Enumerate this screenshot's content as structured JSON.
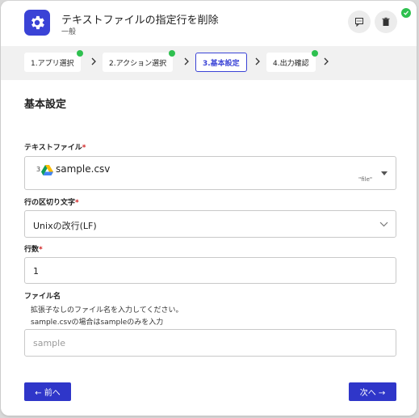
{
  "header": {
    "title": "テキストファイルの指定行を削除",
    "subtitle": "一般",
    "icon": "gear-icon",
    "comment_icon": "comment-icon",
    "delete_icon": "trash-icon",
    "status_icon": "check-icon"
  },
  "steps": [
    {
      "label": "1.アプリ選択",
      "done": true
    },
    {
      "label": "2.アクション選択",
      "done": true
    },
    {
      "label": "3.基本設定",
      "active": true
    },
    {
      "label": "4.出力確認",
      "done": true
    }
  ],
  "section_title": "基本設定",
  "fields": {
    "text_file": {
      "label": "テキストファイル",
      "required": "*",
      "prefix": "3",
      "value": "sample.csv",
      "tag": "\"file\""
    },
    "delimiter": {
      "label": "行の区切り文字",
      "required": "*",
      "value": "Unixの改行(LF)"
    },
    "line_count": {
      "label": "行数",
      "required": "*",
      "value": "1"
    },
    "file_name": {
      "label": "ファイル名",
      "hint1": "拡張子なしのファイル名を入力してください。",
      "hint2": "sample.csvの場合はsampleのみを入力",
      "placeholder": "sample"
    }
  },
  "buttons": {
    "prev": "← 前へ",
    "next": "次へ →"
  },
  "colors": {
    "accent": "#3a43d6",
    "success": "#2ec04f",
    "required": "#d12020"
  }
}
